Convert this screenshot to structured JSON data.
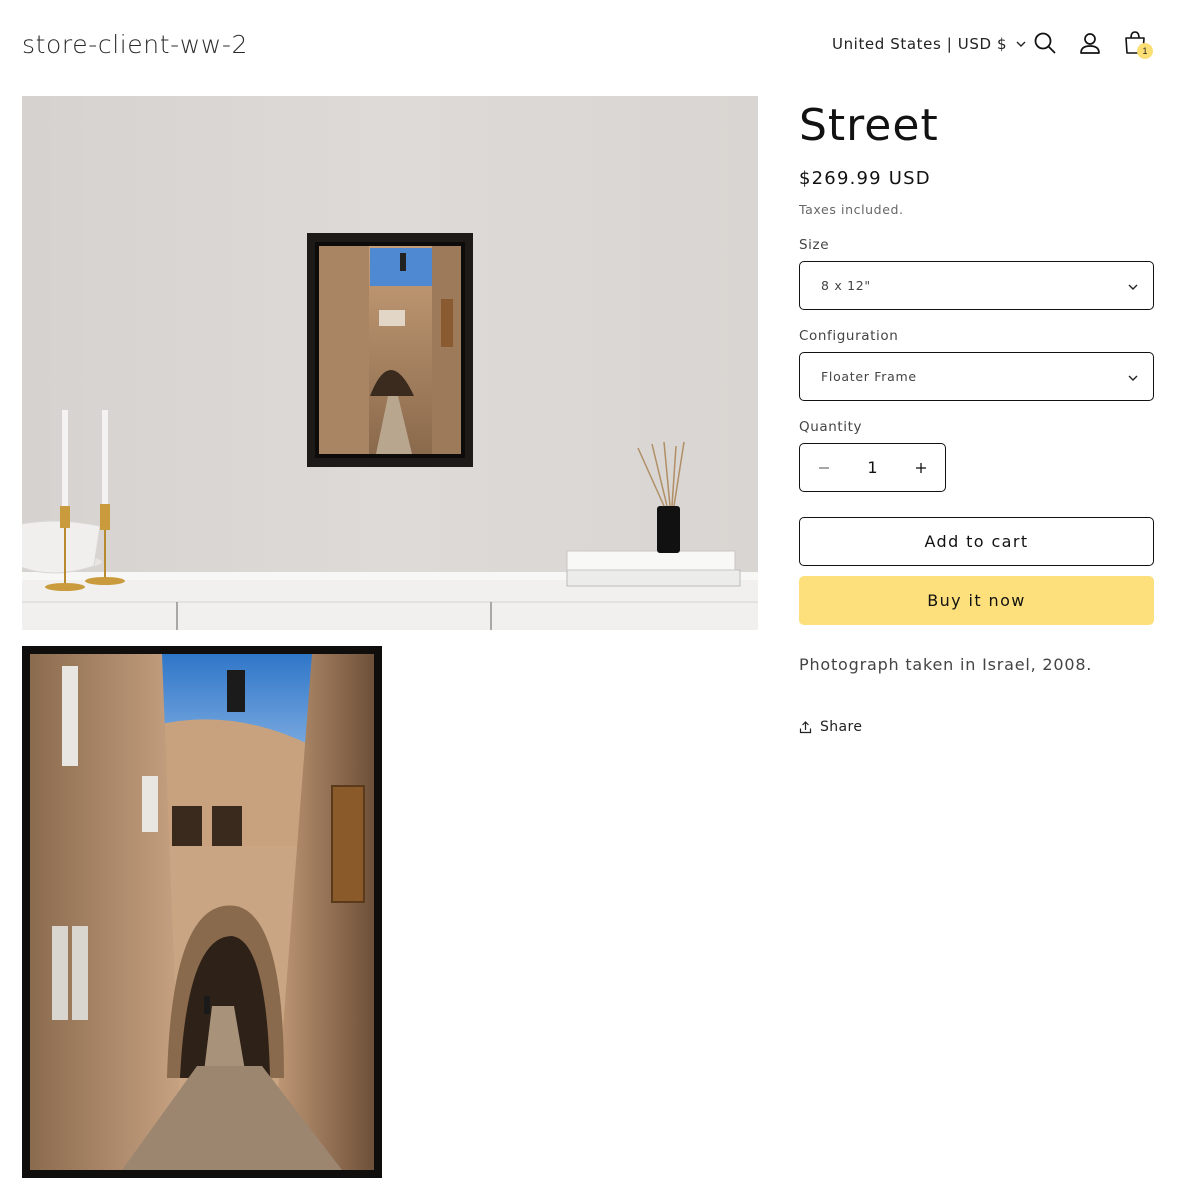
{
  "header": {
    "logo": "store-client-ww-2",
    "localization": "United States | USD $",
    "cart_count": "1"
  },
  "icons": {
    "search": "search-icon",
    "account": "account-icon",
    "cart": "cart-icon",
    "share": "share-icon"
  },
  "product": {
    "title": "Street",
    "price": "$269.99 USD",
    "tax_note": "Taxes included.",
    "size_label": "Size",
    "size_value": "8 x 12\"",
    "configuration_label": "Configuration",
    "configuration_value": "Floater Frame",
    "quantity_label": "Quantity",
    "quantity_value": "1",
    "add_to_cart": "Add to cart",
    "buy_now": "Buy it now",
    "description": "Photograph taken in Israel, 2008.",
    "share": "Share"
  },
  "colors": {
    "buy_button": "#fde07b",
    "cart_badge": "#fcdf74",
    "text": "#121212"
  }
}
